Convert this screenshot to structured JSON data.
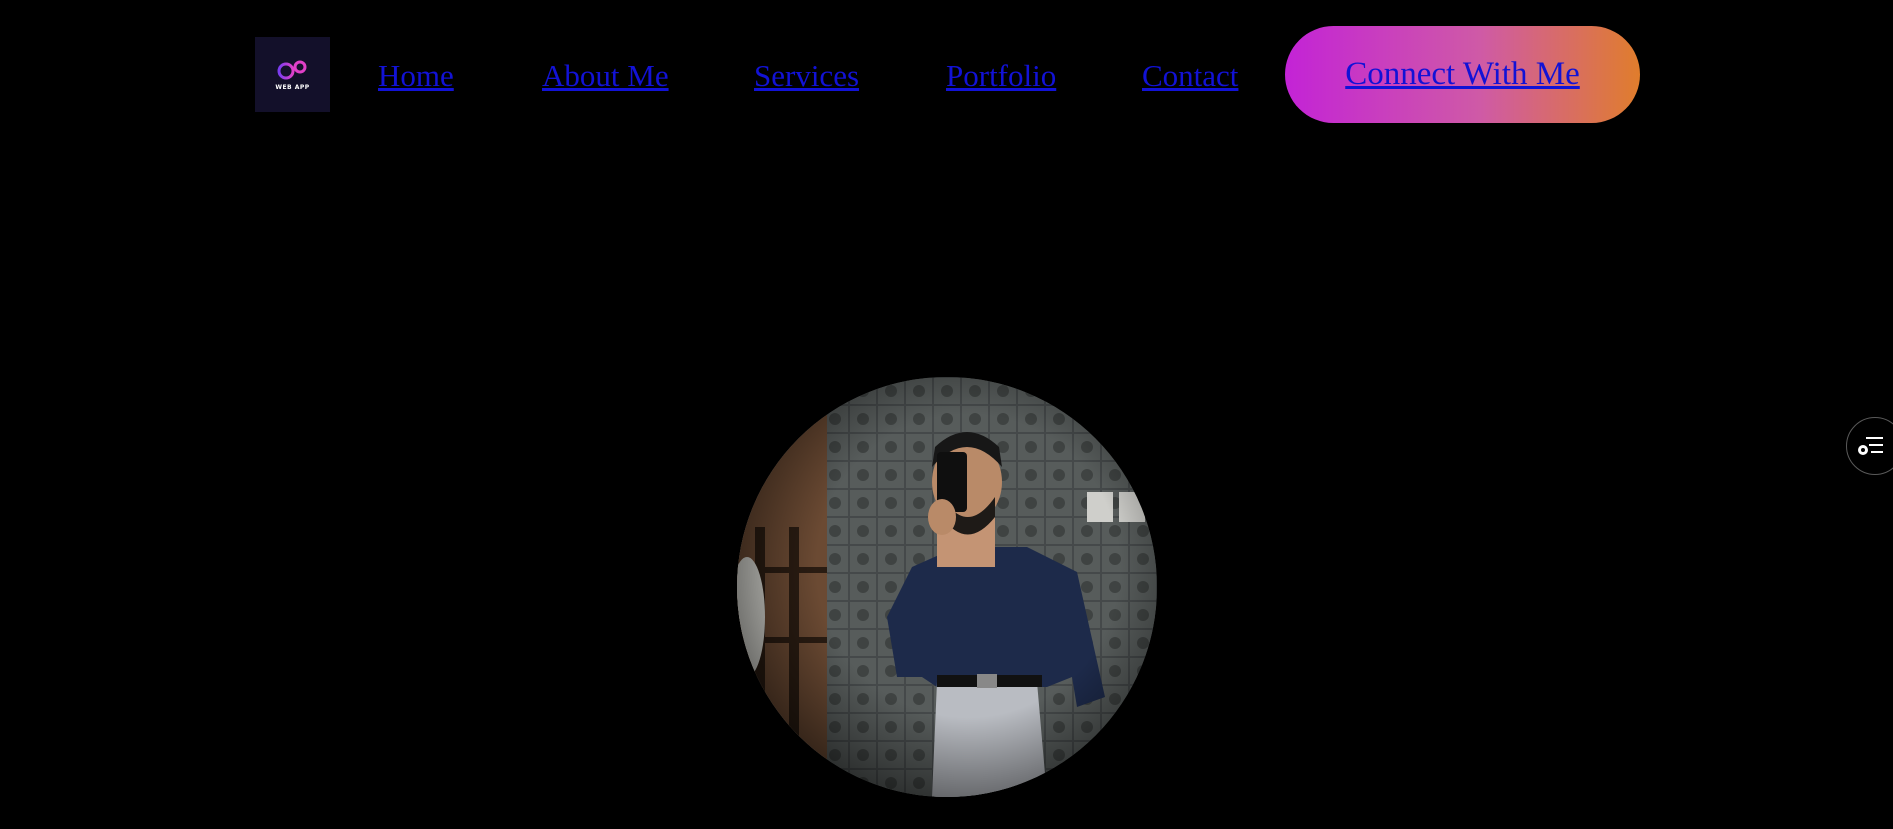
{
  "logo": {
    "text": "WEB APP",
    "icon": "infinity-logo-icon",
    "colors": {
      "background": "#13102a",
      "gradient_start": "#d63fd0",
      "gradient_end": "#7a3cf0"
    }
  },
  "nav": {
    "items": [
      {
        "label": "Home"
      },
      {
        "label": "About Me"
      },
      {
        "label": "Services"
      },
      {
        "label": "Portfolio"
      },
      {
        "label": "Contact"
      }
    ],
    "link_color": "#1212d6"
  },
  "cta": {
    "label": "Connect With Me",
    "gradient": [
      "#c323d6",
      "#e07d2c"
    ]
  },
  "hero": {
    "image": "profile-photo"
  },
  "side_panel": {
    "icon": "settings-list-icon"
  }
}
